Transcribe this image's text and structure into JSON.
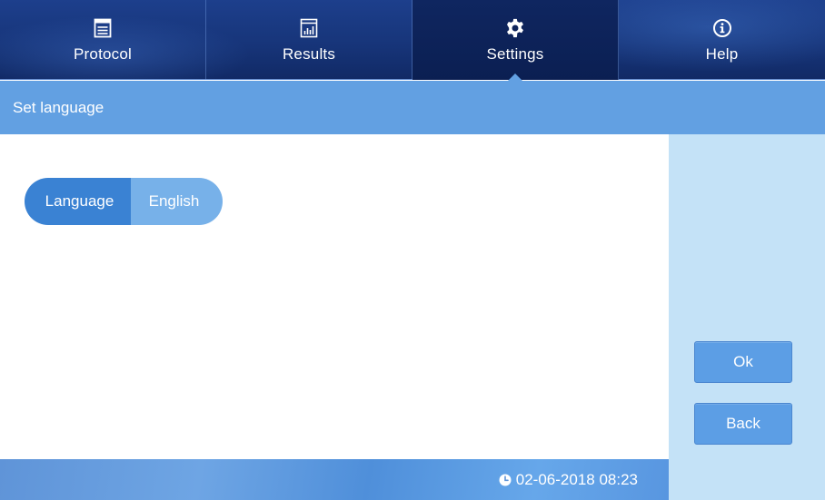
{
  "nav": {
    "tabs": [
      {
        "label": "Protocol",
        "icon": "protocol-icon",
        "active": false
      },
      {
        "label": "Results",
        "icon": "results-chart-icon",
        "active": false
      },
      {
        "label": "Settings",
        "icon": "gear-icon",
        "active": true
      },
      {
        "label": "Help",
        "icon": "info-icon",
        "active": false
      }
    ]
  },
  "title": "Set language",
  "language_setting": {
    "label": "Language",
    "value": "English"
  },
  "buttons": {
    "ok": "Ok",
    "back": "Back"
  },
  "footer": {
    "datetime": "02-06-2018 08:23",
    "icon": "clock-icon"
  },
  "colors": {
    "nav_bg": "#17357a",
    "nav_active": "#0b1f52",
    "title_bar": "#62a0e2",
    "pill_label": "#3a82d3",
    "pill_value": "#77b1e9",
    "side_panel": "#c4e2f7",
    "button": "#5c9ee5"
  }
}
